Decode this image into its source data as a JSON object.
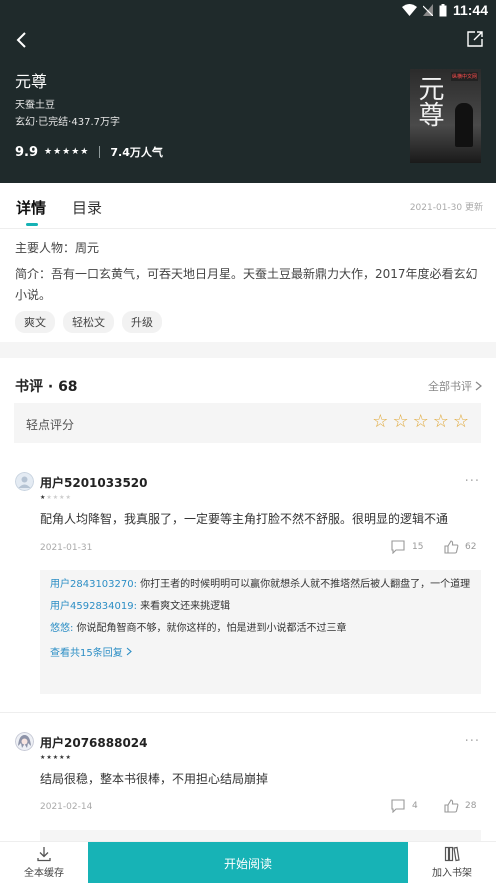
{
  "status_bar": {
    "time": "11:44"
  },
  "book": {
    "title": "元尊",
    "author": "天蚕土豆",
    "meta": "玄幻·已完结·437.7万字",
    "score": "9.9",
    "stars": "★★★★★",
    "popularity": "7.4万人气",
    "cover_title": "元尊",
    "cover_badge": "纵横中文网"
  },
  "tabs": {
    "detail": "详情",
    "catalog": "目录",
    "updated": "2021-01-30 更新"
  },
  "details": {
    "main_character": "主要人物：周元",
    "intro": "简介：吾有一口玄黄气，可吞天地日月星。天蚕土豆最新鼎力大作，2017年度必看玄幻小说。",
    "tags": [
      "爽文",
      "轻松文",
      "升级"
    ]
  },
  "reviews_section": {
    "title": "书评 · 68",
    "all_label": "全部书评",
    "rate_label": "轻点评分",
    "rate_stars": [
      "☆",
      "☆",
      "☆",
      "☆",
      "☆"
    ]
  },
  "reviews": [
    {
      "username": "用户5201033520",
      "stars_filled": "★",
      "stars_empty": "★★★★",
      "text": "配角人均降智，我真服了，一定要等主角打脸不然不舒服。很明显的逻辑不通",
      "date": "2021-01-31",
      "comments": "15",
      "likes": "62",
      "replies": [
        {
          "user": "用户2843103270:",
          "text": " 你打王者的时候明明可以赢你就想杀人就不推塔然后被人翻盘了，一个道理"
        },
        {
          "user": "用户4592834019:",
          "text": " 来看爽文还来挑逻辑"
        },
        {
          "user": "悠悠:",
          "text": " 你说配角智商不够，就你这样的，怕是进到小说都活不过三章"
        }
      ],
      "see_more": "查看共15条回复"
    },
    {
      "username": "用户2076888024",
      "stars_filled": "★★★★★",
      "stars_empty": "",
      "text": "结局很稳，整本书很棒，不用担心结局崩掉",
      "date": "2021-02-14",
      "comments": "4",
      "likes": "28"
    }
  ],
  "bottom_bar": {
    "cache": "全本缓存",
    "start": "开始阅读",
    "shelf": "加入书架"
  },
  "colors": {
    "accent": "#17b3b6",
    "header_bg": "#1f2a2b",
    "star": "#e0a93b",
    "link": "#2c8ec5"
  }
}
